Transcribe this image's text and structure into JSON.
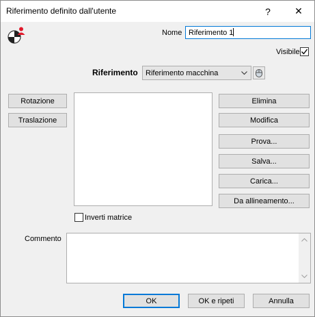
{
  "window": {
    "title": "Riferimento definito dall'utente",
    "help_glyph": "?",
    "close_glyph": "✕"
  },
  "name_field": {
    "label": "Nome",
    "value": "Riferimento 1"
  },
  "visible": {
    "label": "Visibile",
    "checked": true
  },
  "reference": {
    "label": "Riferimento",
    "selected": "Riferimento macchina"
  },
  "left_buttons": {
    "rotation": "Rotazione",
    "translation": "Traslazione"
  },
  "right_buttons": {
    "delete": "Elimina",
    "modify": "Modifica",
    "try": "Prova...",
    "save": "Salva...",
    "load": "Carica...",
    "from_alignment": "Da allineamento..."
  },
  "invert_matrix": {
    "label": "Inverti matrice",
    "checked": false
  },
  "comment": {
    "label": "Commento",
    "value": ""
  },
  "footer": {
    "ok": "OK",
    "ok_repeat": "OK e ripeti",
    "cancel": "Annulla"
  },
  "icons": {
    "app": "user-reference-icon",
    "combo_arrow": "chevron-down-icon",
    "pick": "mouse-pick-icon"
  },
  "colors": {
    "accent": "#0078d7",
    "app_icon_red": "#e0192b"
  }
}
